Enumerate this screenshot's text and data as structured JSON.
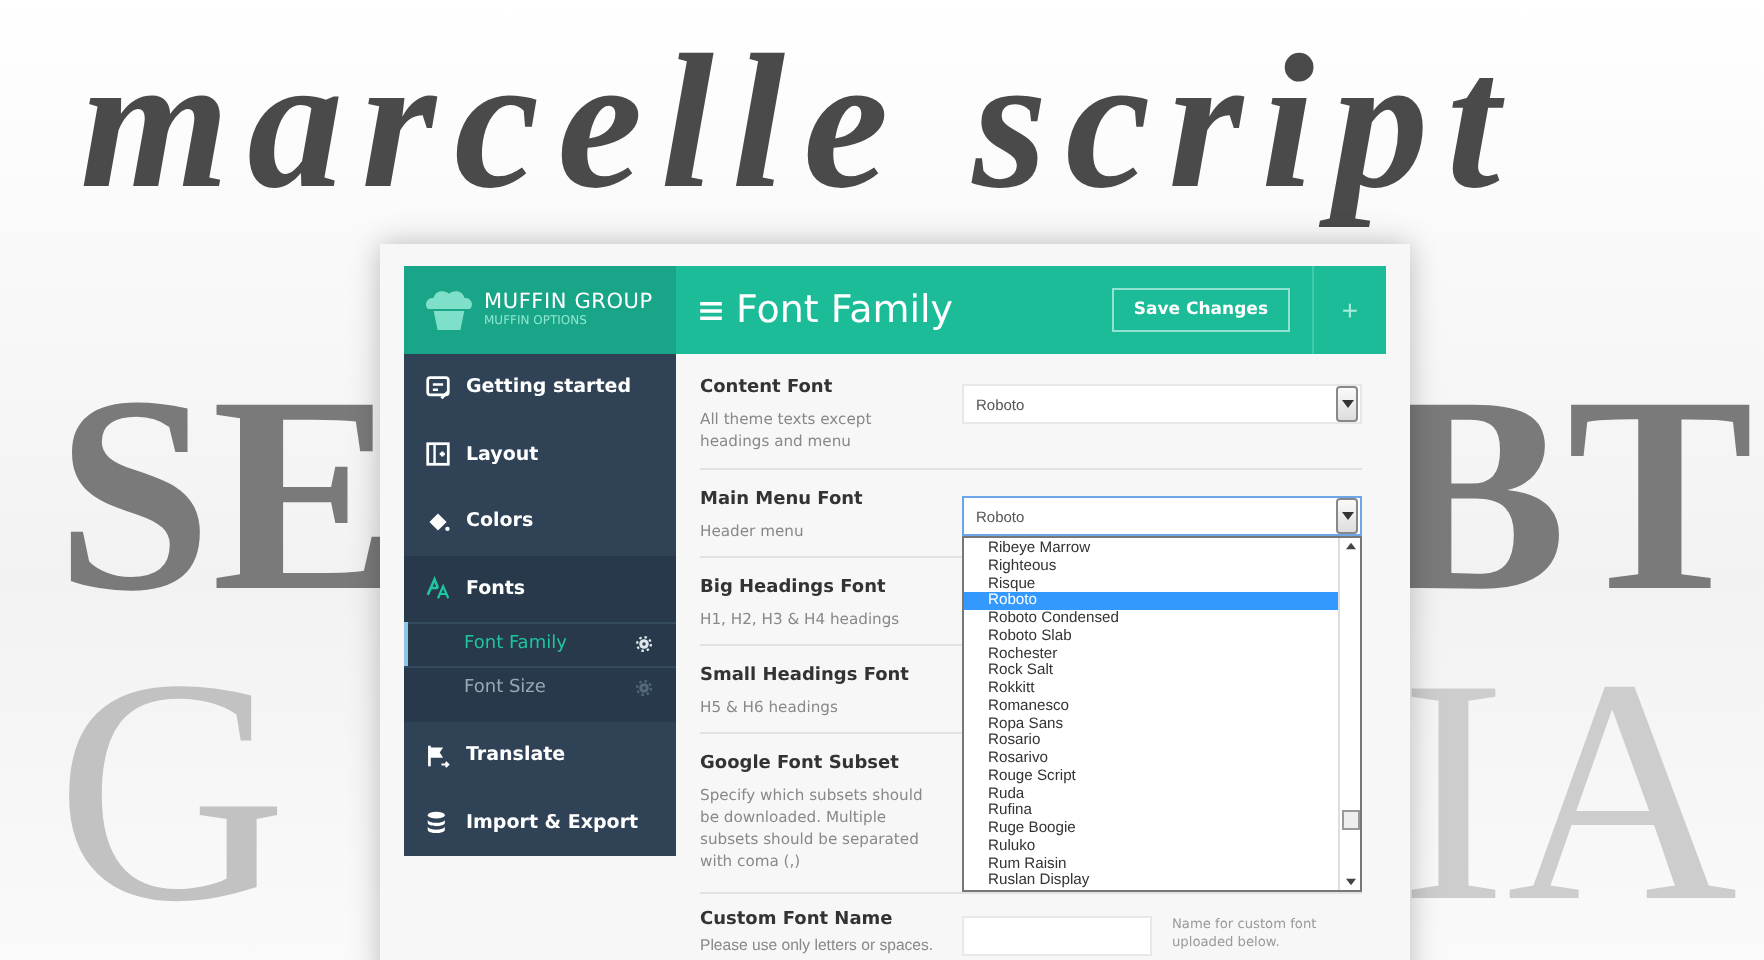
{
  "background_text": {
    "script_line": "marcelle script",
    "left_upper": "SE",
    "right_upper": "BT",
    "left_lower": "G",
    "right_lower": "IA"
  },
  "brand": {
    "name": "MUFFIN GROUP",
    "subtitle": "MUFFIN OPTIONS"
  },
  "sidebar": {
    "items": [
      {
        "label": "Getting started",
        "selected": false
      },
      {
        "label": "Layout",
        "selected": false
      },
      {
        "label": "Colors",
        "selected": false
      },
      {
        "label": "Fonts",
        "selected": true,
        "children": [
          {
            "label": "Font Family",
            "selected": true
          },
          {
            "label": "Font Size",
            "selected": false
          }
        ]
      },
      {
        "label": "Translate",
        "selected": false
      },
      {
        "label": "Import & Export",
        "selected": false
      }
    ]
  },
  "header": {
    "title": "Font Family",
    "save_button": "Save Changes",
    "add_button": "+"
  },
  "fields": [
    {
      "kind": "select",
      "label": "Content Font",
      "description": "All theme texts except headings and menu",
      "value": "Roboto",
      "open": false
    },
    {
      "kind": "select",
      "label": "Main Menu Font",
      "description": "Header menu",
      "value": "Roboto",
      "open": true,
      "options": [
        {
          "label": "Ribeye Marrow",
          "selected": false
        },
        {
          "label": "Righteous",
          "selected": false
        },
        {
          "label": "Risque",
          "selected": false
        },
        {
          "label": "Roboto",
          "selected": true
        },
        {
          "label": "Roboto Condensed",
          "selected": false
        },
        {
          "label": "Roboto Slab",
          "selected": false
        },
        {
          "label": "Rochester",
          "selected": false
        },
        {
          "label": "Rock Salt",
          "selected": false
        },
        {
          "label": "Rokkitt",
          "selected": false
        },
        {
          "label": "Romanesco",
          "selected": false
        },
        {
          "label": "Ropa Sans",
          "selected": false
        },
        {
          "label": "Rosario",
          "selected": false
        },
        {
          "label": "Rosarivo",
          "selected": false
        },
        {
          "label": "Rouge Script",
          "selected": false
        },
        {
          "label": "Ruda",
          "selected": false
        },
        {
          "label": "Rufina",
          "selected": false
        },
        {
          "label": "Ruge Boogie",
          "selected": false
        },
        {
          "label": "Ruluko",
          "selected": false
        },
        {
          "label": "Rum Raisin",
          "selected": false
        },
        {
          "label": "Ruslan Display",
          "selected": false
        }
      ]
    },
    {
      "kind": "hidden",
      "label": "Big Headings Font",
      "description": "H1, H2, H3 & H4 headings"
    },
    {
      "kind": "hidden",
      "label": "Small Headings Font",
      "description": "H5 & H6 headings"
    },
    {
      "kind": "hidden",
      "label": "Google Font Subset",
      "description": "Specify which subsets should be downloaded. Multiple subsets should be separated with coma (,)"
    },
    {
      "kind": "text",
      "label": "Custom Font Name",
      "description": "Please use only letters or spaces.",
      "note": "Name for custom font uploaded below."
    }
  ]
}
